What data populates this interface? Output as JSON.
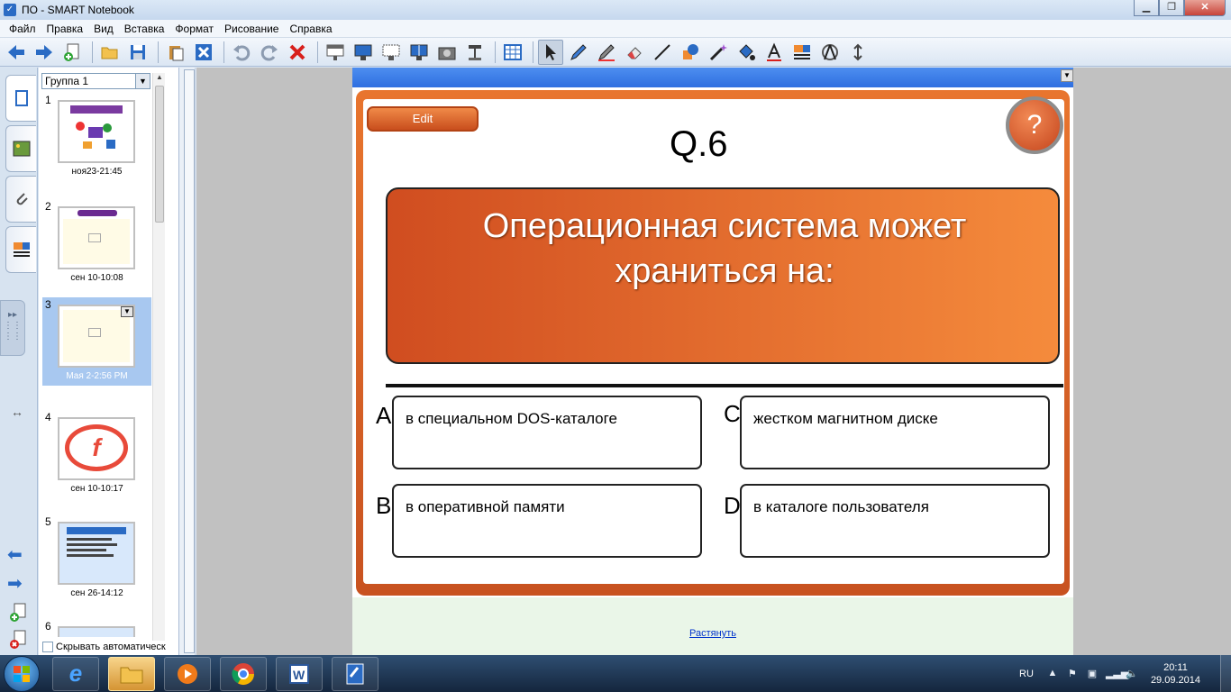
{
  "window": {
    "title": "ПО - SMART Notebook"
  },
  "menu": [
    "Файл",
    "Правка",
    "Вид",
    "Вставка",
    "Формат",
    "Рисование",
    "Справка"
  ],
  "sorter": {
    "group": "Группа 1",
    "autohide_label": "Скрывать автоматическ",
    "thumbnails": [
      {
        "num": "1",
        "caption": "ноя23-21:45",
        "selected": false
      },
      {
        "num": "2",
        "caption": "сен 10-10:08",
        "selected": false
      },
      {
        "num": "3",
        "caption": "Мая 2-2:56 PM",
        "selected": true
      },
      {
        "num": "4",
        "caption": "сен 10-10:17",
        "selected": false
      },
      {
        "num": "5",
        "caption": "сен 26-14:12",
        "selected": false
      },
      {
        "num": "6",
        "caption": "",
        "selected": false
      }
    ]
  },
  "slide": {
    "edit_label": "Edit",
    "question_number": "Q.6",
    "help_symbol": "?",
    "question_line1": "Операционная система может",
    "question_line2": "храниться на:",
    "answers": [
      {
        "letter": "A",
        "text": "в специальном DOS-каталоге"
      },
      {
        "letter": "B",
        "text": "в оперативной памяти"
      },
      {
        "letter": "C",
        "text": "жестком магнитном диске"
      },
      {
        "letter": "D",
        "text": "в каталоге пользователя"
      }
    ],
    "stretch_label": "Растянуть"
  },
  "taskbar": {
    "language": "RU",
    "time": "20:11",
    "date": "29.09.2014"
  },
  "colors": {
    "accent_orange": "#e8752e",
    "selection_blue": "#a8c8f0",
    "canvas_bar": "#2f6fe0"
  }
}
